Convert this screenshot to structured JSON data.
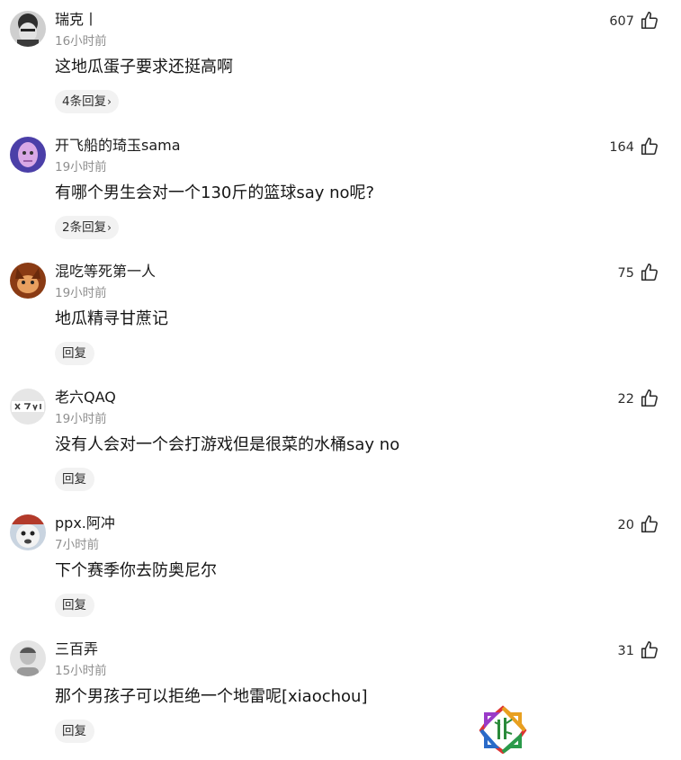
{
  "comments": [
    {
      "username": "瑞克丨",
      "time": "16小时前",
      "text": "这地瓜蛋子要求还挺高啊",
      "reply_label": "4条回复",
      "reply_chevron": "›",
      "likes": "607",
      "avatar_colors": [
        "#3b3b3b",
        "#d8d8d8"
      ]
    },
    {
      "username": "开飞船的琦玉sama",
      "time": "19小时前",
      "text": "有哪个男生会对一个130斤的篮球say no呢?",
      "reply_label": "2条回复",
      "reply_chevron": "›",
      "likes": "164",
      "avatar_colors": [
        "#4b3fa8",
        "#d9a8e6"
      ]
    },
    {
      "username": "混吃等死第一人",
      "time": "19小时前",
      "text": "地瓜精寻甘蔗记",
      "reply_label": "回复",
      "reply_chevron": "",
      "likes": "75",
      "avatar_colors": [
        "#8a3b14",
        "#e8a060"
      ]
    },
    {
      "username": "老六QAQ",
      "time": "19小时前",
      "text": "没有人会对一个会打游戏但是很菜的水桶say no",
      "reply_label": "回复",
      "reply_chevron": "",
      "likes": "22",
      "avatar_colors": [
        "#e6e6e6",
        "#3a3a3a"
      ]
    },
    {
      "username": "ppx.阿冲",
      "time": "7小时前",
      "text": "下个赛季你去防奥尼尔",
      "reply_label": "回复",
      "reply_chevron": "",
      "likes": "20",
      "avatar_colors": [
        "#c9d4e0",
        "#b33a2a"
      ]
    },
    {
      "username": "三百弄",
      "time": "15小时前",
      "text": "那个男孩子可以拒绝一个地雷呢[xiaochou]",
      "reply_label": "回复",
      "reply_chevron": "",
      "likes": "31",
      "avatar_colors": [
        "#e4e4e4",
        "#555555"
      ]
    }
  ],
  "icons": {
    "like": "thumbs-up-outline-icon",
    "watermark": "bamboo-logo-icon"
  },
  "colors": {
    "text_primary": "#161616",
    "text_secondary": "#8f8f8f",
    "reply_pill_bg": "#f2f2f2"
  }
}
